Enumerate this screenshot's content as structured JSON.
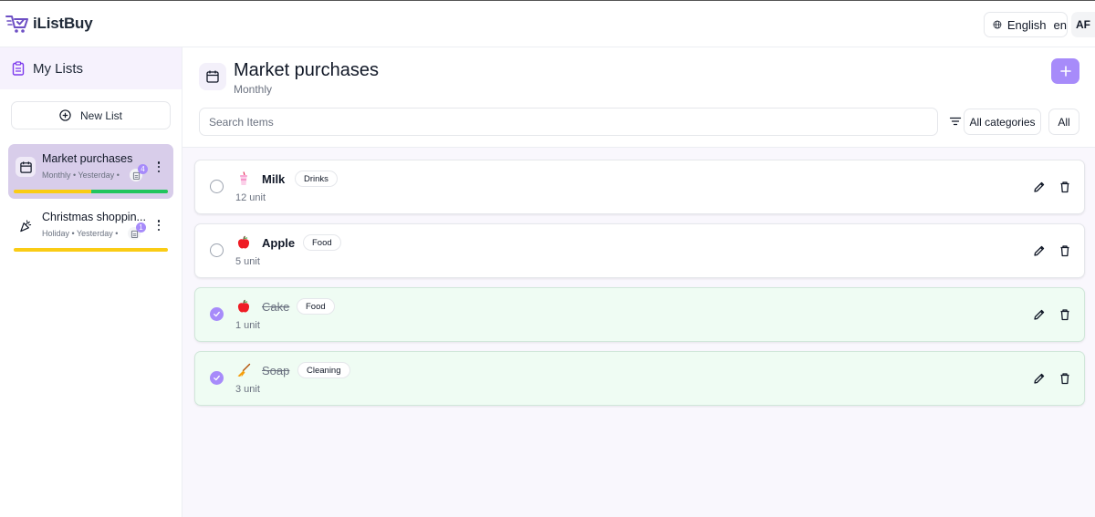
{
  "app": {
    "name": "iListBuy",
    "language_label": "English",
    "language_code": "en",
    "user_initials": "AF"
  },
  "sidebar": {
    "title": "My Lists",
    "new_list_label": "New List",
    "lists": [
      {
        "name": "Market purchases",
        "meta": "Monthly • Yesterday •",
        "item_count": "4",
        "completion": 0.5,
        "active": true
      },
      {
        "name": "Christmas shoppin...",
        "meta": "Holiday • Yesterday •",
        "item_count": "1",
        "completion": 0,
        "active": false
      }
    ]
  },
  "main": {
    "title": "Market purchases",
    "subtitle": "Monthly",
    "search_placeholder": "Search Items",
    "category_filter": "All categories",
    "status_filter": "All",
    "items": [
      {
        "name": "Milk",
        "category": "Drinks",
        "quantity": "12 unit",
        "checked": false,
        "icon": "milk-cup-icon"
      },
      {
        "name": "Apple",
        "category": "Food",
        "quantity": "5 unit",
        "checked": false,
        "icon": "apple-icon"
      },
      {
        "name": "Cake",
        "category": "Food",
        "quantity": "1 unit",
        "checked": true,
        "icon": "apple-icon"
      },
      {
        "name": "Soap",
        "category": "Cleaning",
        "quantity": "3 unit",
        "checked": true,
        "icon": "broom-icon"
      }
    ]
  },
  "colors": {
    "accent": "#a78bfa",
    "progress_done": "#22c55e",
    "progress_pending": "#facc15",
    "done_row_bg": "#effcf3"
  }
}
